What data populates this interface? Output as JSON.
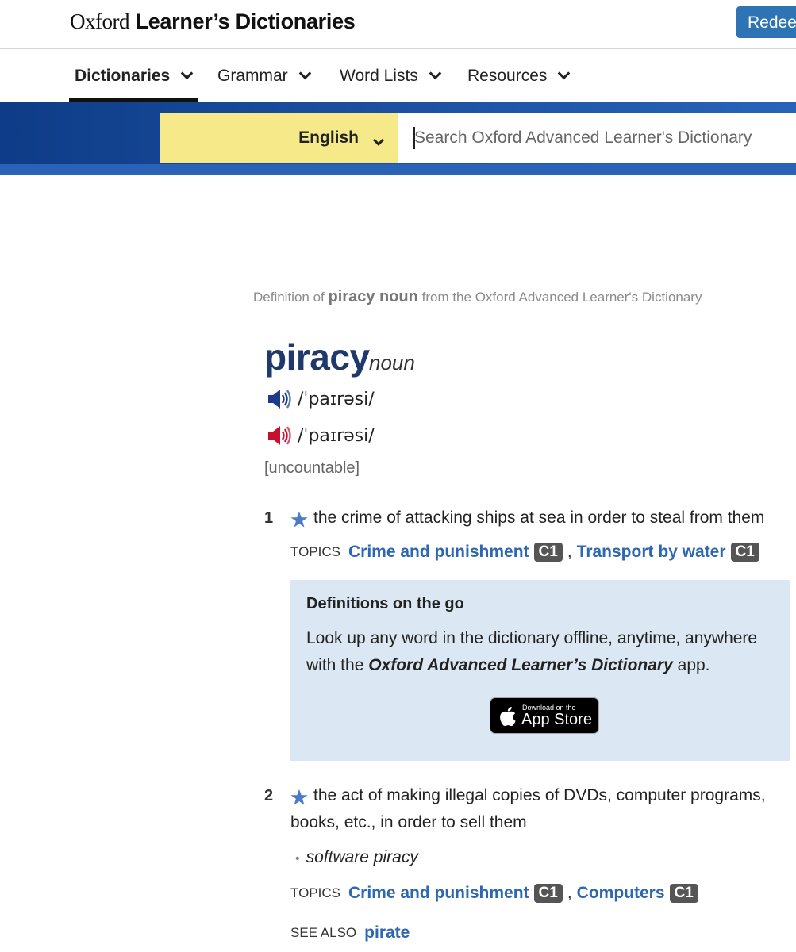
{
  "header": {
    "logo_brand": "Oxford",
    "logo_name": "Learner’s Dictionaries",
    "redeem_label": "Redeem"
  },
  "nav": {
    "items": [
      {
        "label": "Dictionaries",
        "active": true
      },
      {
        "label": "Grammar"
      },
      {
        "label": "Word Lists"
      },
      {
        "label": "Resources"
      }
    ]
  },
  "search": {
    "language": "English",
    "placeholder": "Search Oxford Advanced Learner's Dictionary"
  },
  "entry": {
    "definition_of_prefix": "Definition of",
    "definition_of_word": "piracy noun",
    "definition_of_suffix": "from the Oxford Advanced Learner's Dictionary",
    "headword": "piracy",
    "pos": "noun",
    "phonetic_br": "/ˈpaɪrəsi/",
    "phonetic_us": "/ˈpaɪrəsi/",
    "grammar": "[uncountable]",
    "senses": [
      {
        "num": "1",
        "definition": "the crime of attacking ships at sea in order to steal from them",
        "topics_label": "TOPICS",
        "topics": [
          {
            "label": "Crime and punishment",
            "level": "C1"
          },
          {
            "label": "Transport by water",
            "level": "C1"
          }
        ]
      },
      {
        "num": "2",
        "definition": "the act of making illegal copies of DVDs, computer programs, books, etc., in order to sell them",
        "example": "software piracy",
        "topics_label": "TOPICS",
        "topics": [
          {
            "label": "Crime and punishment",
            "level": "C1"
          },
          {
            "label": "Computers",
            "level": "C1"
          }
        ],
        "see_also_label": "SEE ALSO",
        "see_also": "pirate"
      }
    ]
  },
  "promo": {
    "title": "Definitions on the go",
    "text_before": "Look up any word in the dictionary offline, anytime, anywhere with the",
    "text_bold": "Oxford Advanced Learner’s Dictionary",
    "text_after": "app.",
    "appstore_small": "Download on the",
    "appstore_big": "App Store"
  },
  "colors": {
    "accent_blue": "#2d67b1",
    "header_band": "#1b4f9e",
    "lang_yellow": "#f6e98a",
    "headword_navy": "#1f3a6a",
    "promo_bg": "#dbe8f3",
    "br_audio": "#1f3a8a",
    "us_audio": "#c8102e",
    "star": "#4a7bc8"
  }
}
